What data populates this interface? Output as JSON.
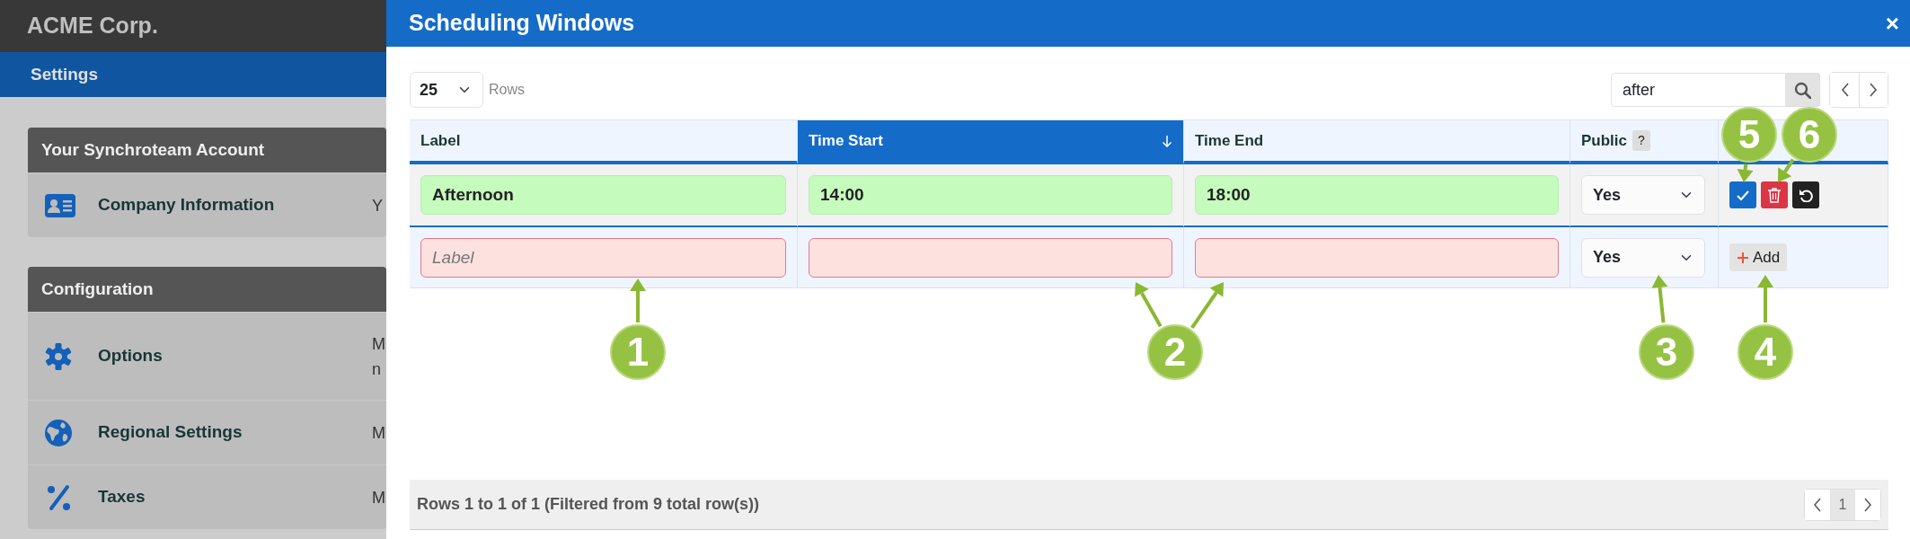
{
  "sidebar": {
    "brand": "ACME Corp.",
    "section": "Settings",
    "cards": [
      {
        "title": "Your Synchroteam Account",
        "items": [
          {
            "label": "Company Information",
            "description_lines": [
              "Y"
            ]
          }
        ]
      },
      {
        "title": "Configuration",
        "items": [
          {
            "label": "Options",
            "description_lines": [
              "M",
              "n"
            ]
          },
          {
            "label": "Regional Settings",
            "description_lines": [
              "M"
            ]
          },
          {
            "label": "Taxes",
            "description_lines": [
              "M"
            ]
          }
        ]
      }
    ]
  },
  "modal": {
    "title": "Scheduling Windows",
    "close": "×",
    "page_size": "25",
    "rows_label": "Rows",
    "search": {
      "value": "after"
    },
    "table": {
      "columns": [
        {
          "label": "Label",
          "sorted": false
        },
        {
          "label": "Time Start",
          "sorted": true
        },
        {
          "label": "Time End",
          "sorted": false
        },
        {
          "label": "Public",
          "sorted": false,
          "help": "?"
        }
      ],
      "rows": [
        {
          "kind": "existing",
          "label": "Afternoon",
          "time_start": "14:00",
          "time_end": "18:00",
          "public": "Yes"
        },
        {
          "kind": "new",
          "label_placeholder": "Label",
          "public": "Yes",
          "add": "Add"
        }
      ]
    },
    "footer": {
      "summary": "Rows 1 to 1 of 1 (Filtered from 9 total row(s))",
      "pages": [
        {
          "label": "1",
          "selected": true
        }
      ]
    }
  },
  "callouts": [
    {
      "number": "5"
    },
    {
      "number": "6"
    },
    {
      "number": "1"
    },
    {
      "number": "2"
    },
    {
      "number": "3"
    },
    {
      "number": "4"
    }
  ]
}
